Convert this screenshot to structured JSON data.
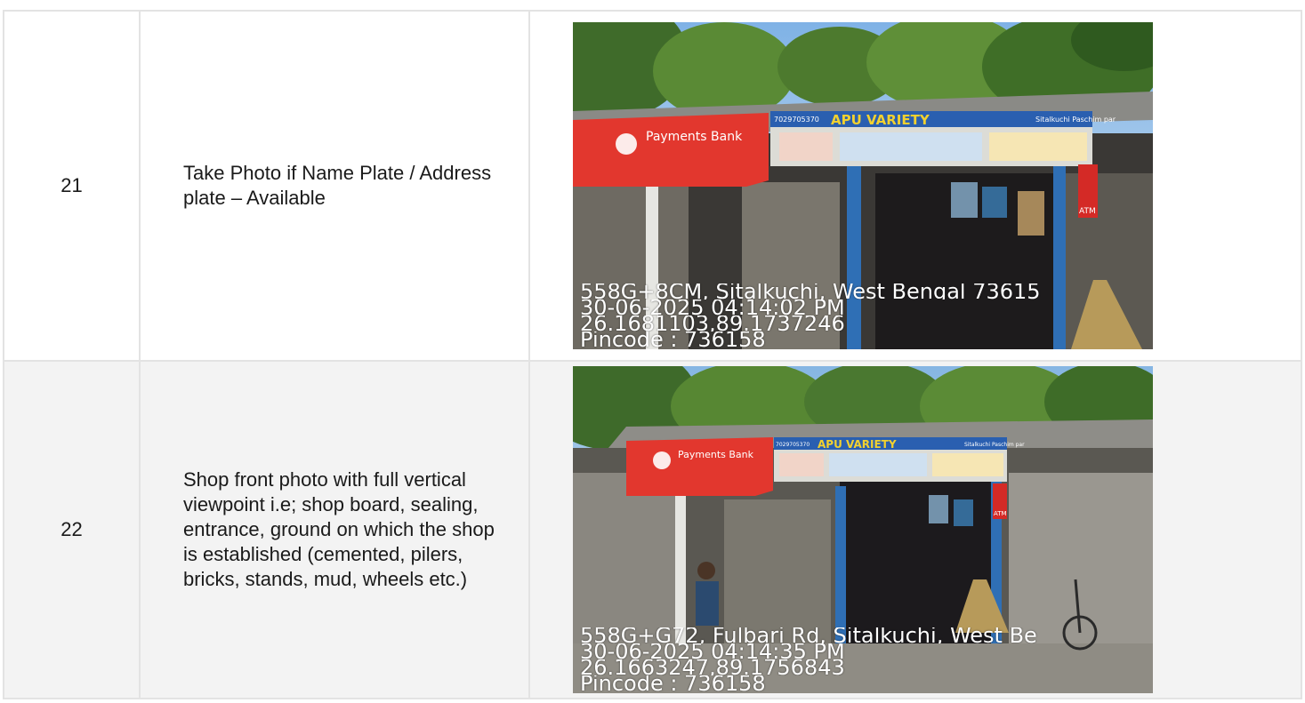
{
  "rows": [
    {
      "number": "21",
      "description": "Take Photo if Name Plate / Address plate – Available",
      "photo": {
        "address": "558G+8CM, Sitalkuchi, West Bengal 73615",
        "datetime": "30-06-2025 04:14:02 PM",
        "coords": "26.1681103,89.1737246",
        "pincode": "Pincode : 736158",
        "sign_brand": "Payments Bank",
        "sign_shop": "APU VARIETY",
        "sign_phone": "7029705370",
        "sign_area": "Sitalkuchi Paschim par",
        "atm_label": "ATM"
      }
    },
    {
      "number": "22",
      "description": "Shop front photo with full vertical viewpoint i.e; shop board, sealing, entrance, ground on which the shop is established (cemented, pilers, bricks, stands, mud, wheels etc.)",
      "photo": {
        "address": "558G+G72, Fulbari Rd, Sitalkuchi, West Be",
        "datetime": "30-06-2025 04:14:35 PM",
        "coords": "26.1663247,89.1756843",
        "pincode": "Pincode : 736158",
        "sign_brand": "Payments Bank",
        "sign_shop": "APU VARIETY",
        "sign_phone": "7029705370",
        "sign_area": "Sitalkuchi Paschim par",
        "atm_label": "ATM"
      }
    }
  ]
}
